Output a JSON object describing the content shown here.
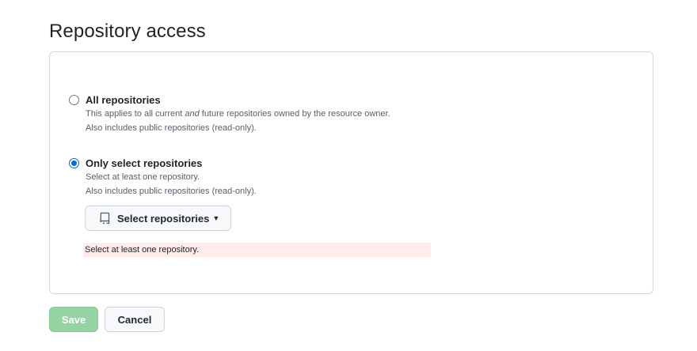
{
  "section": {
    "title": "Repository access"
  },
  "options": {
    "all": {
      "label": "All repositories",
      "desc_line1_pre": "This applies to all current ",
      "desc_line1_em": "and",
      "desc_line1_post": " future repositories owned by the resource owner.",
      "desc_line2": "Also includes public repositories (read-only).",
      "selected": false
    },
    "select": {
      "label": "Only select repositories",
      "desc_line1": "Select at least one repository.",
      "desc_line2": "Also includes public repositories (read-only).",
      "selected": true
    }
  },
  "select_button": {
    "label": "Select repositories",
    "icon": "repo-icon"
  },
  "error": {
    "text": "Select at least one repository."
  },
  "actions": {
    "save_label": "Save",
    "cancel_label": "Cancel"
  },
  "colors": {
    "accent": "#0969da",
    "save_disabled_bg": "#94d3a2",
    "error_bg": "#ffebe9"
  }
}
